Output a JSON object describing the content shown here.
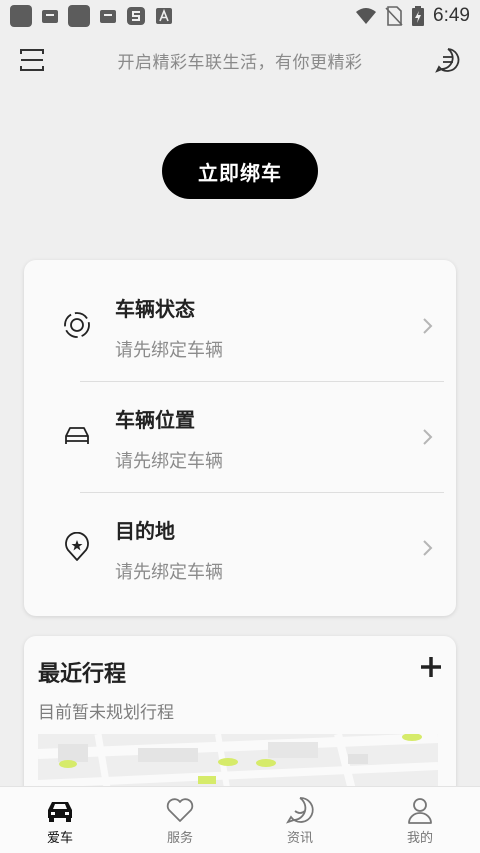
{
  "status_bar": {
    "time": "6:49",
    "icons": [
      "app-icon",
      "bag-icon",
      "app-icon",
      "bag-icon",
      "s-app-icon",
      "a-app-icon",
      "wifi-icon",
      "no-sim-icon",
      "battery-charging-icon"
    ]
  },
  "header": {
    "slogan": "开启精彩车联生活，有你更精彩",
    "left_icon": "menu-icon",
    "right_icon": "chat-icon"
  },
  "bind_button": {
    "label": "立即绑车"
  },
  "vehicle_card": {
    "items": [
      {
        "title": "车辆状态",
        "subtitle": "请先绑定车辆",
        "icon": "target-icon"
      },
      {
        "title": "车辆位置",
        "subtitle": "请先绑定车辆",
        "icon": "car-outline-icon"
      },
      {
        "title": "目的地",
        "subtitle": "请先绑定车辆",
        "icon": "location-star-icon"
      }
    ]
  },
  "trip_card": {
    "title": "最近行程",
    "subtitle": "目前暂未规划行程",
    "add_icon": "plus-icon"
  },
  "tab_bar": {
    "tabs": [
      {
        "label": "爱车",
        "icon": "car-icon",
        "active": true
      },
      {
        "label": "服务",
        "icon": "heart-icon",
        "active": false
      },
      {
        "label": "资讯",
        "icon": "message-icon",
        "active": false
      },
      {
        "label": "我的",
        "icon": "person-icon",
        "active": false
      }
    ]
  },
  "colors": {
    "background": "#efefef",
    "card": "#fafafa",
    "primary_button": "#000000",
    "map_highlight": "#d6eb6a"
  }
}
